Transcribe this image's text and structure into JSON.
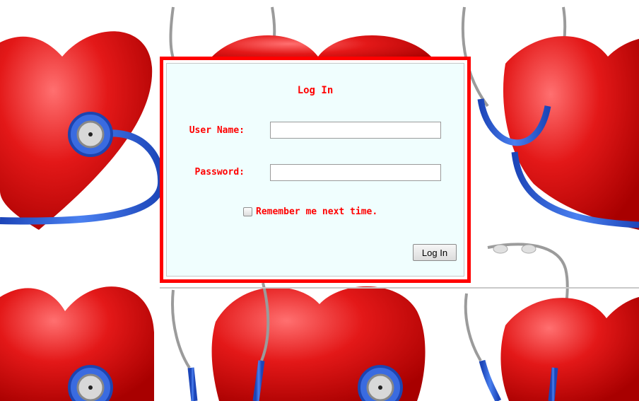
{
  "login": {
    "title": "Log In",
    "username_label": "User Name:",
    "username_value": "",
    "password_label": "Password:",
    "password_value": "",
    "remember_label": "Remember me next time.",
    "remember_checked": false,
    "submit_label": "Log In"
  },
  "theme": {
    "frame_border": "#ff0000",
    "panel_background": "#f0fefe",
    "label_color": "#ff0000",
    "heart_color": "#e31818",
    "stethoscope_color": "#2a5fd9"
  },
  "background": {
    "pattern": "heart-with-stethoscope"
  }
}
